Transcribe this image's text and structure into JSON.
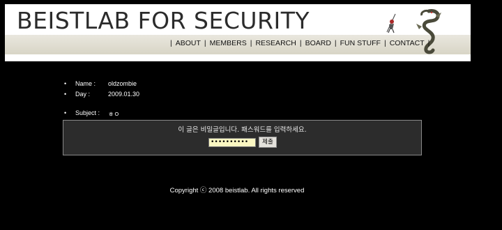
{
  "header": {
    "title": "BEISTLAB FOR SECURITY",
    "nav": [
      "ABOUT",
      "MEMBERS",
      "RESEARCH",
      "BOARD",
      "FUN STUFF",
      "CONTACT"
    ]
  },
  "post": {
    "name_label": "Name :",
    "name_value": "oldzombie",
    "day_label": "Day :",
    "day_value": "2009.01.30",
    "subject_label": "Subject :",
    "subject_value": "ㅎㅇ"
  },
  "password_form": {
    "prompt": "이 글은 비밀글입니다. 패스워드를 입력하세요.",
    "input_value": "••••••••••",
    "submit_label": "제출"
  },
  "footer": {
    "copyright": "Copyright ⓒ 2008 beistlab. All rights reserved"
  },
  "colors": {
    "background": "#000000",
    "banner_band": "#d8d5c6",
    "input_bg": "#fbf7c2"
  }
}
